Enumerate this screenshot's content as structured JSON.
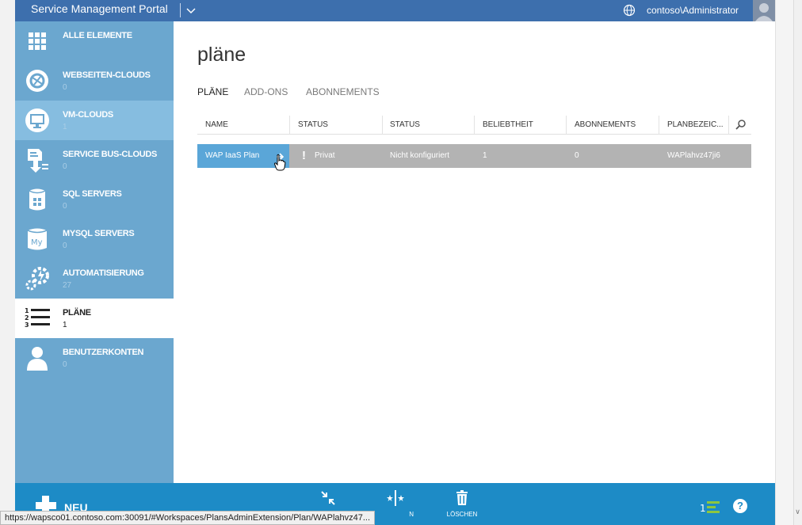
{
  "header": {
    "portal_title": "Service Management Portal",
    "user": "contoso\\Administrator"
  },
  "sidebar": {
    "items": [
      {
        "label": "ALLE ELEMENTE",
        "count": "",
        "icon": "grid-icon"
      },
      {
        "label": "WEBSEITEN-CLOUDS",
        "count": "0",
        "icon": "websites-icon"
      },
      {
        "label": "VM-CLOUDS",
        "count": "1",
        "icon": "monitor-icon"
      },
      {
        "label": "SERVICE BUS-CLOUDS",
        "count": "0",
        "icon": "service-bus-icon"
      },
      {
        "label": "SQL SERVERS",
        "count": "0",
        "icon": "sql-database-icon"
      },
      {
        "label": "MYSQL SERVERS",
        "count": "0",
        "icon": "mysql-database-icon"
      },
      {
        "label": "AUTOMATISIERUNG",
        "count": "27",
        "icon": "gears-icon"
      },
      {
        "label": "PLÄNE",
        "count": "1",
        "icon": "numbered-list-icon"
      },
      {
        "label": "BENUTZERKONTEN",
        "count": "0",
        "icon": "user-icon"
      }
    ]
  },
  "main": {
    "title": "pläne",
    "tabs": [
      {
        "label": "PLÄNE",
        "active": true
      },
      {
        "label": "ADD-ONS",
        "active": false
      },
      {
        "label": "ABONNEMENTS",
        "active": false
      }
    ],
    "table": {
      "columns": [
        "NAME",
        "STATUS",
        "STATUS",
        "BELIEBTHEIT",
        "ABONNEMENTS",
        "PLANBEZEIC..."
      ],
      "rows": [
        {
          "name": "WAP IaaS Plan",
          "status": "Privat",
          "status2": "Nicht konfiguriert",
          "beliebtheit": "1",
          "abonnements": "0",
          "planbezeichnung": "WAPlahvz47ji6"
        }
      ]
    }
  },
  "commandbar": {
    "new_label": "NEU",
    "delete_label": "LÖSCHEN",
    "partial_label": "N"
  },
  "statusbar": {
    "url": "https://wapsco01.contoso.com:30091/#Workspaces/PlansAdminExtension/Plan/WAPlahvz47..."
  },
  "colors": {
    "topbar": "#3d6fad",
    "sidebar": "#6ba7cf",
    "commandbar": "#1d8bc6",
    "selected_name_cell": "#5aa6d8",
    "selected_row": "#b3b3b3",
    "list_icon_accent": "#8dc63f"
  }
}
